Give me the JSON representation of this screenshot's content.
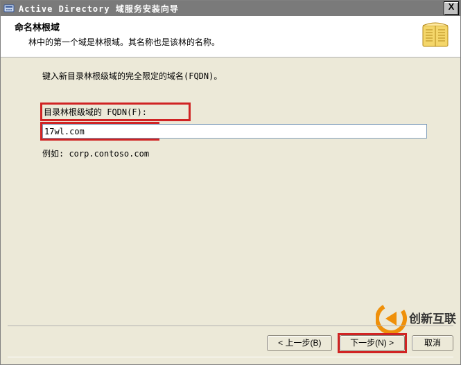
{
  "titlebar": {
    "title": "Active Directory 域服务安装向导",
    "close_label": "X"
  },
  "header": {
    "heading": "命名林根域",
    "subtitle": "林中的第一个域是林根域。其名称也是该林的名称。"
  },
  "content": {
    "instruction": "键入新目录林根级域的完全限定的域名(FQDN)。",
    "field_label": "目录林根级域的 FQDN(F):",
    "field_value": "17wl.com",
    "example": "例如: corp.contoso.com"
  },
  "buttons": {
    "back": "< 上一步(B)",
    "next": "下一步(N) >",
    "cancel": "取消"
  },
  "watermark": {
    "text": "创新互联"
  }
}
